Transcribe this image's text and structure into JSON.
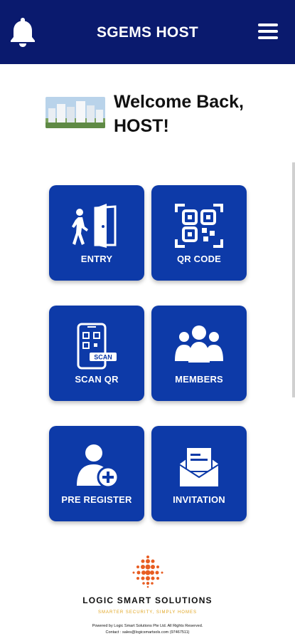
{
  "header": {
    "title": "SGEMS HOST",
    "bell_icon": "bell-icon",
    "menu_icon": "hamburger-menu-icon",
    "bg_color": "#0a1a6e"
  },
  "welcome": {
    "line1": "Welcome Back,",
    "line2": "HOST!",
    "image": "building-thumbnail"
  },
  "tiles": [
    {
      "label": "ENTRY",
      "icon": "entry-door-icon"
    },
    {
      "label": "QR CODE",
      "icon": "qr-code-icon"
    },
    {
      "label": "SCAN QR",
      "icon": "scan-qr-phone-icon"
    },
    {
      "label": "MEMBERS",
      "icon": "members-group-icon"
    },
    {
      "label": "PRE REGISTER",
      "icon": "user-add-icon"
    },
    {
      "label": "INVITATION",
      "icon": "invitation-envelope-icon"
    }
  ],
  "tile_color": "#0d3aa8",
  "footer": {
    "brand": "LOGIC SMART SOLUTIONS",
    "tagline": "SMARTER SECURITY, SIMPLY HOMES",
    "legal_line1": "Powered by Logic Smart Solutions Pte Ltd. All Rights Reserved.",
    "legal_line2": "Contact : sales@logicsmartsols.com (97467511)",
    "accent_color": "#e0a41f"
  }
}
